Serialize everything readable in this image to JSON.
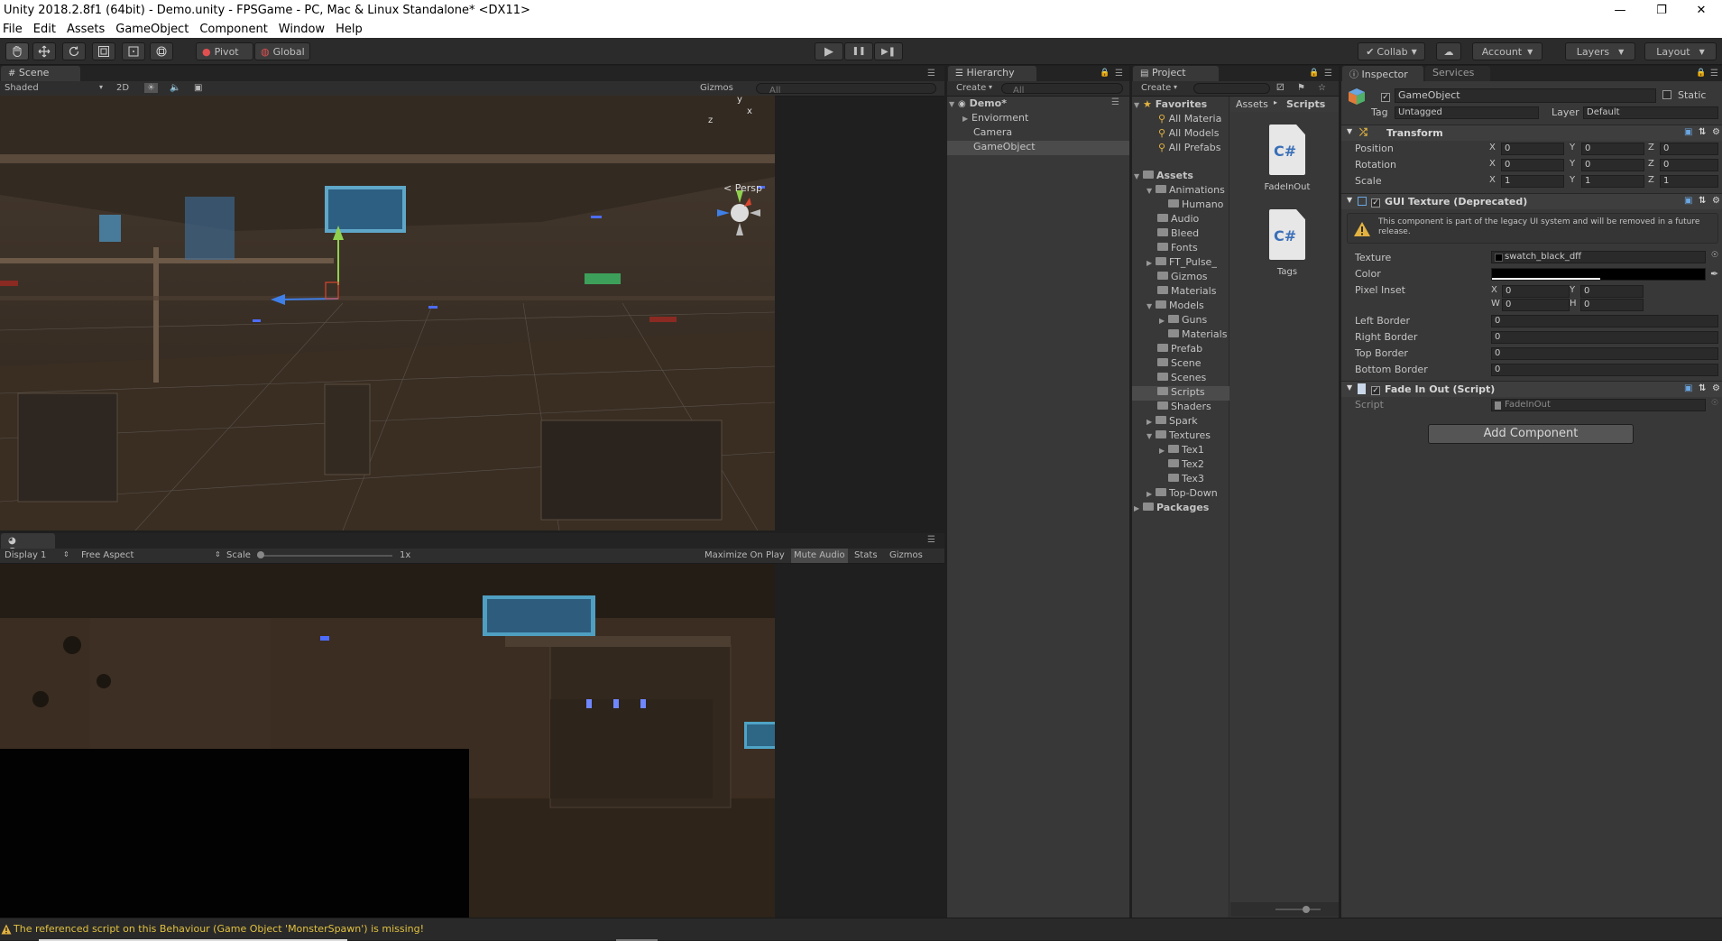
{
  "window": {
    "title": "Unity 2018.2.8f1 (64bit) - Demo.unity - FPSGame - PC, Mac & Linux Standalone* <DX11>",
    "controls": [
      "—",
      "❐",
      "✕"
    ]
  },
  "menu": [
    "File",
    "Edit",
    "Assets",
    "GameObject",
    "Component",
    "Window",
    "Help"
  ],
  "toolbar": {
    "tools": [
      "hand-tool",
      "move-tool",
      "rotate-tool",
      "scale-tool",
      "rect-tool",
      "transform-tool"
    ],
    "pivot": "Pivot",
    "global": "Global",
    "play": "▶",
    "pause": "❚❚",
    "step": "▶❚",
    "collab": "Collab",
    "account": "Account",
    "layers": "Layers",
    "layout": "Layout"
  },
  "scene": {
    "tab": "Scene",
    "shading": "Shaded",
    "mode2d": "2D",
    "gizmos": "Gizmos",
    "search_placeholder": "All",
    "persp": "< Persp",
    "axis_y": "y",
    "axis_x": "x",
    "axis_z": "z"
  },
  "game": {
    "tab": "Game",
    "display": "Display 1",
    "aspect": "Free Aspect",
    "scale_label": "Scale",
    "scale_value": "1x",
    "maximize": "Maximize On Play",
    "mute": "Mute Audio",
    "stats": "Stats",
    "gizmos": "Gizmos"
  },
  "hierarchy": {
    "tab": "Hierarchy",
    "create": "Create",
    "search_placeholder": "All",
    "scene_name": "Demo*",
    "items": [
      "Enviorment",
      "Camera",
      "GameObject"
    ]
  },
  "project": {
    "tab": "Project",
    "create": "Create",
    "favorites_label": "Favorites",
    "favorites": [
      "All Materia",
      "All Models",
      "All Prefabs"
    ],
    "assets_label": "Assets",
    "folders": [
      "Animations",
      "Humano",
      "Audio",
      "Bleed",
      "Fonts",
      "FT_Pulse_",
      "Gizmos",
      "Materials",
      "Models",
      "Guns",
      "Materials",
      "Prefab",
      "Scene",
      "Scenes",
      "Scripts",
      "Shaders",
      "Spark",
      "Textures",
      "Tex1",
      "Tex2",
      "Tex3",
      "Top-Down"
    ],
    "packages_label": "Packages",
    "breadcrumb_root": "Assets",
    "breadcrumb_sep": "▸",
    "breadcrumb_current": "Scripts",
    "files": [
      {
        "icon": "C#",
        "name": "FadeInOut"
      },
      {
        "icon": "C#",
        "name": "Tags"
      }
    ]
  },
  "inspector": {
    "tab": "Inspector",
    "tab2": "Services",
    "object_name": "GameObject",
    "static": "Static",
    "tag_label": "Tag",
    "tag_value": "Untagged",
    "layer_label": "Layer",
    "layer_value": "Default",
    "transform": {
      "title": "Transform",
      "rows": [
        {
          "label": "Position",
          "x": "0",
          "y": "0",
          "z": "0"
        },
        {
          "label": "Rotation",
          "x": "0",
          "y": "0",
          "z": "0"
        },
        {
          "label": "Scale",
          "x": "1",
          "y": "1",
          "z": "1"
        }
      ],
      "axis": [
        "X",
        "Y",
        "Z"
      ]
    },
    "gui_texture": {
      "title": "GUI Texture (Deprecated)",
      "warning": "This component is part of the legacy UI system and will be removed in a future release.",
      "texture_label": "Texture",
      "texture_value": "swatch_black_dff",
      "color_label": "Color",
      "pixel_inset_label": "Pixel Inset",
      "inset": {
        "x": "0",
        "y": "0",
        "w": "0",
        "h": "0"
      },
      "inset_axis": [
        "X",
        "Y",
        "W",
        "H"
      ],
      "borders": [
        {
          "label": "Left Border",
          "value": "0"
        },
        {
          "label": "Right Border",
          "value": "0"
        },
        {
          "label": "Top Border",
          "value": "0"
        },
        {
          "label": "Bottom Border",
          "value": "0"
        }
      ]
    },
    "fade_script": {
      "title": "Fade In Out (Script)",
      "script_label": "Script",
      "script_value": "FadeInOut"
    },
    "add_component": "Add Component"
  },
  "status": {
    "message": "The referenced script on this Behaviour (Game Object 'MonsterSpawn') is missing!"
  },
  "colors": {
    "editor_bg": "#383838",
    "panel_dark": "#232323",
    "selection": "#3e5f96",
    "warning": "#e0c040",
    "gizmo_y": "#8fd14f",
    "gizmo_x": "#d9452d",
    "gizmo_z": "#3f7fe8"
  }
}
